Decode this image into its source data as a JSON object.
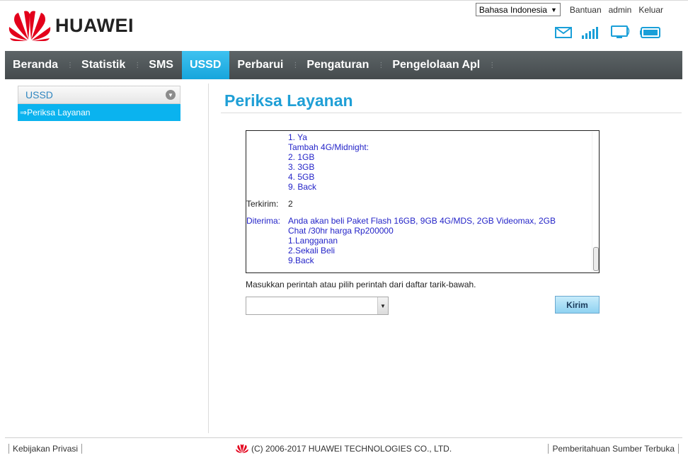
{
  "brand": {
    "name": "HUAWEI"
  },
  "header": {
    "language": "Bahasa Indonesia",
    "links": [
      "Bantuan",
      "admin",
      "Keluar"
    ],
    "status_icons": [
      "mail-icon",
      "signal-icon",
      "monitor-icon",
      "battery-icon"
    ]
  },
  "nav": {
    "items": [
      "Beranda",
      "Statistik",
      "SMS",
      "USSD",
      "Perbarui",
      "Pengaturan",
      "Pengelolaan Apl"
    ],
    "active": "USSD"
  },
  "sidebar": {
    "section": "USSD",
    "items": [
      "Periksa Layanan"
    ]
  },
  "main": {
    "title": "Periksa Layanan",
    "log_lines": [
      {
        "label": "",
        "text": "1. Ya",
        "color": "blue"
      },
      {
        "label": "",
        "text": "Tambah 4G/Midnight:",
        "color": "blue"
      },
      {
        "label": "",
        "text": "2. 1GB",
        "color": "blue"
      },
      {
        "label": "",
        "text": "3. 3GB",
        "color": "blue"
      },
      {
        "label": "",
        "text": "4. 5GB",
        "color": "blue"
      },
      {
        "label": "",
        "text": "9. Back",
        "color": "blue"
      }
    ],
    "sent_label": "Terkirim:",
    "sent_value": "2",
    "received_label": "Diterima:",
    "received_lines": [
      "Anda akan beli Paket Flash 16GB, 9GB 4G/MDS, 2GB Videomax, 2GB",
      "Chat /30hr harga Rp200000",
      "1.Langganan",
      "2.Sekali Beli",
      "9.Back"
    ],
    "instruction": "Masukkan perintah atau pilih perintah dari daftar tarik-bawah.",
    "command_value": "",
    "send_label": "Kirim"
  },
  "footer": {
    "privacy": "Kebijakan Privasi",
    "copyright": "(C) 2006-2017 HUAWEI TECHNOLOGIES CO., LTD.",
    "open_source": "Pemberitahuan Sumber Terbuka"
  },
  "colors": {
    "accent": "#1f9fd6",
    "nav_bg": "#4f5557",
    "nav_active": "#17a5dc",
    "ussd_blue_text": "#2424c8",
    "brand_red": "#e3001b"
  }
}
